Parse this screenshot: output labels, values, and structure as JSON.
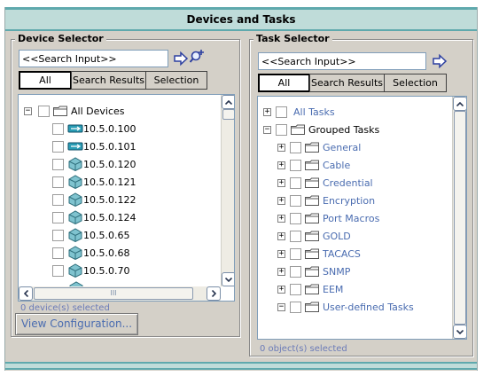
{
  "window": {
    "title": "Devices and Tasks"
  },
  "device_selector": {
    "legend": "Device Selector",
    "search": {
      "value": "<<Search Input>>"
    },
    "tabs": [
      {
        "label": "All",
        "active": true
      },
      {
        "label": "Search Results",
        "active": false
      },
      {
        "label": "Selection",
        "active": false
      }
    ],
    "tree": {
      "root": {
        "label": "All Devices",
        "expander": "−"
      },
      "items": [
        {
          "label": "10.5.0.100",
          "icon": "router-icon"
        },
        {
          "label": "10.5.0.101",
          "icon": "router-icon"
        },
        {
          "label": "10.5.0.120",
          "icon": "switch-icon"
        },
        {
          "label": "10.5.0.121",
          "icon": "switch-icon"
        },
        {
          "label": "10.5.0.122",
          "icon": "switch-icon"
        },
        {
          "label": "10.5.0.124",
          "icon": "switch-icon"
        },
        {
          "label": "10.5.0.65",
          "icon": "switch-icon"
        },
        {
          "label": "10.5.0.68",
          "icon": "switch-icon"
        },
        {
          "label": "10.5.0.70",
          "icon": "switch-icon"
        }
      ]
    },
    "hscroll_grip": "III",
    "status": "0 device(s) selected",
    "view_button": "View Configuration..."
  },
  "task_selector": {
    "legend": "Task Selector",
    "search": {
      "value": "<<Search Input>>"
    },
    "tabs": [
      {
        "label": "All",
        "active": true
      },
      {
        "label": "Search Results",
        "active": false
      },
      {
        "label": "Selection",
        "active": false
      }
    ],
    "tree": {
      "top": [
        {
          "label": "All Tasks",
          "expander": "+",
          "style": "link"
        },
        {
          "label": "Grouped Tasks",
          "expander": "−",
          "style": "plain"
        }
      ],
      "groups": [
        {
          "label": "General",
          "expander": "+"
        },
        {
          "label": "Cable",
          "expander": "+"
        },
        {
          "label": "Credential",
          "expander": "+"
        },
        {
          "label": "Encryption",
          "expander": "+"
        },
        {
          "label": "Port Macros",
          "expander": "+"
        },
        {
          "label": "GOLD",
          "expander": "+"
        },
        {
          "label": "TACACS",
          "expander": "+"
        },
        {
          "label": "SNMP",
          "expander": "+"
        },
        {
          "label": "EEM",
          "expander": "+"
        },
        {
          "label": "User-defined Tasks",
          "expander": "−"
        }
      ]
    },
    "status": "0 object(s) selected"
  },
  "colors": {
    "title_band": "#bfdcd9",
    "title_border": "#5fa9ad",
    "panel_bg": "#d4d0c8",
    "link_text": "#4a6cb0"
  }
}
